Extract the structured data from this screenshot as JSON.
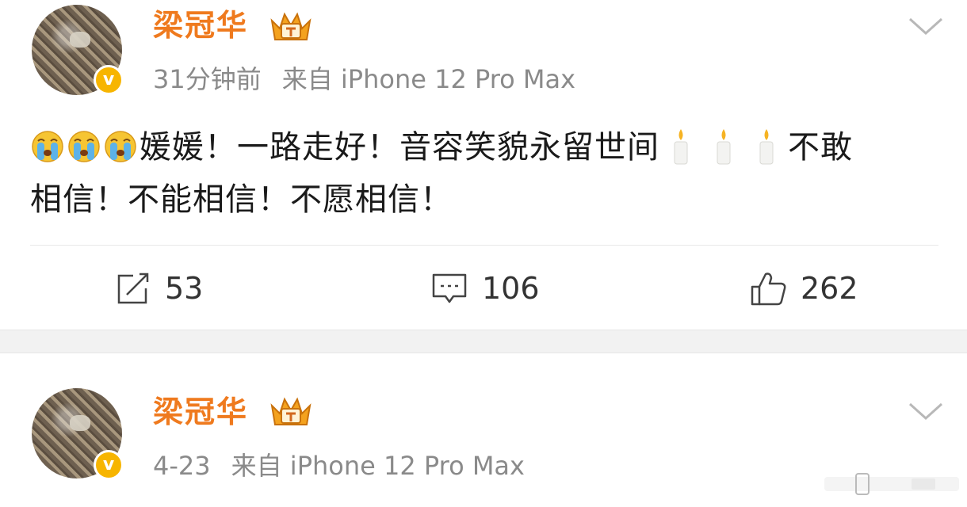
{
  "posts": [
    {
      "author": "梁冠华",
      "time": "31分钟前",
      "source": "来自 iPhone 12 Pro Max",
      "content_line1": "媛媛！一路走好！音容笑貌永留世间",
      "content_line1_end": "不敢",
      "content_line2": "相信！不能相信！不愿相信！",
      "emoji": [
        "crying-face",
        "crying-face",
        "crying-face"
      ],
      "candles": [
        "candle",
        "candle",
        "candle"
      ],
      "actions": {
        "repost": "53",
        "comment": "106",
        "like": "262"
      }
    },
    {
      "author": "梁冠华",
      "time": "4-23",
      "source": "来自 iPhone 12 Pro Max"
    }
  ],
  "colors": {
    "author": "#ef7a1e",
    "meta": "#8a8a8a",
    "verified": "#f7b500",
    "separator": "#f2f2f2"
  },
  "icons": [
    "crown-vip-icon",
    "verified-badge-icon",
    "chevron-down-icon",
    "repost-icon",
    "comment-icon",
    "like-icon"
  ]
}
